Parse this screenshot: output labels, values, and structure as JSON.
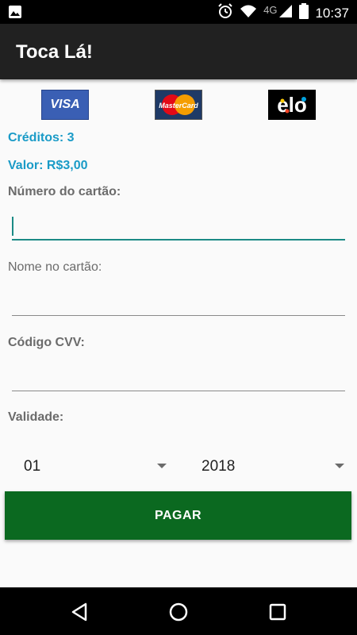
{
  "status_bar": {
    "network": "4G",
    "time": "10:37"
  },
  "app": {
    "title": "Toca Lá!"
  },
  "cards": {
    "visa": "VISA",
    "mastercard": "MasterCard",
    "elo": "elo"
  },
  "credits_text": "Créditos: 3",
  "value_text": "Valor: R$3,00",
  "form": {
    "card_number_label": "Número do cartão:",
    "card_number_value": "",
    "name_label": "Nome no cartão:",
    "name_value": "",
    "cvv_label": "Código CVV:",
    "cvv_value": "",
    "validity_label": "Validade:",
    "month": "01",
    "year": "2018",
    "pay_button": "PAGAR"
  },
  "colors": {
    "accent_blue": "#1a9bc7",
    "pay_green": "#0b6920",
    "field_focus": "#1b8a85",
    "app_bar": "#212121"
  }
}
